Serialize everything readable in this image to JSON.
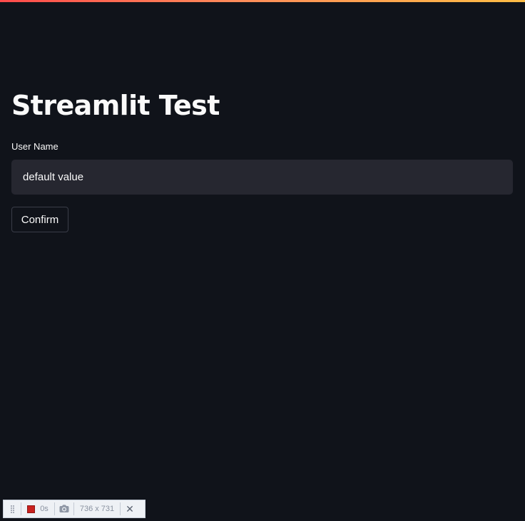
{
  "app": {
    "title": "Streamlit Test",
    "accent_color": "#ff4b4b",
    "background_color": "#10131a"
  },
  "form": {
    "field_label": "User Name",
    "input_value": "default value",
    "button_label": "Confirm"
  },
  "recorder": {
    "timer": "0s",
    "dimensions": "736 x 731",
    "icons": {
      "drag": "drag-handle-icon",
      "stop": "record-stop-icon",
      "camera": "camera-icon",
      "close": "close-icon"
    }
  }
}
